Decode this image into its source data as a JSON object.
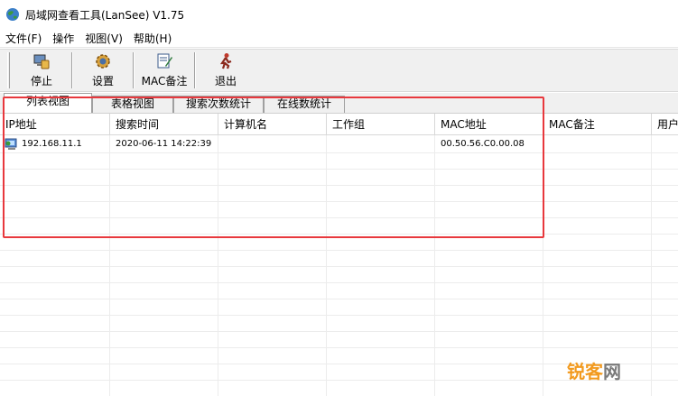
{
  "window": {
    "title": "局域网查看工具(LanSee) V1.75"
  },
  "menu": [
    "文件(F)",
    "操作",
    "视图(V)",
    "帮助(H)"
  ],
  "toolbar": {
    "stop_label": "停止",
    "settings_label": "设置",
    "mac_note_label": "MAC备注",
    "exit_label": "退出"
  },
  "tabs": [
    "列表视图",
    "表格视图",
    "搜索次数统计",
    "在线数统计"
  ],
  "active_tab": "列表视图",
  "columns": [
    "IP地址",
    "搜索时间",
    "计算机名",
    "工作组",
    "MAC地址",
    "MAC备注",
    "用户"
  ],
  "rows": [
    {
      "ip": "192.168.11.1",
      "time": "2020-06-11 14:22:39",
      "computer": "",
      "workgroup": "",
      "mac": "00.50.56.C0.00.08",
      "mac_note": "",
      "user": ""
    }
  ],
  "watermark": {
    "part1": "锐客",
    "part2": "网"
  },
  "colors": {
    "highlight": "#e8383d",
    "watermark_orange": "#f29a1f",
    "watermark_gray": "#7a7a7a"
  }
}
